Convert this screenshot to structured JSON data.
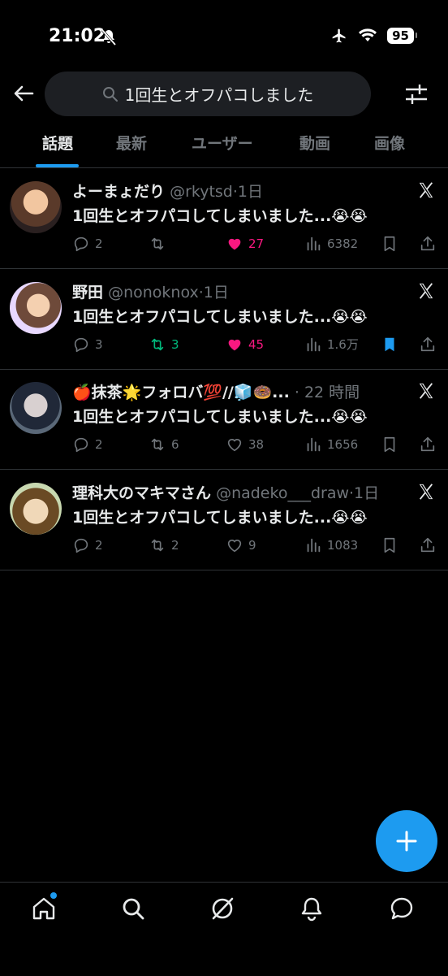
{
  "status": {
    "time": "21:02",
    "battery": "95"
  },
  "search": {
    "query": "1回生とオフパコしました"
  },
  "tabs": [
    "話題",
    "最新",
    "ユーザー",
    "動画",
    "画像"
  ],
  "tweets": [
    {
      "name": "よーまょだり",
      "handle": "@rkytsd",
      "time": "·1日",
      "text": "1回生とオフパコしてしまいました...😭😭",
      "replies": "2",
      "retweets": "",
      "likes": "27",
      "views": "6382",
      "liked": true,
      "retweeted": false,
      "bookmarked": false
    },
    {
      "name": "野田",
      "handle": "@nonoknox",
      "time": "·1日",
      "text": "1回生とオフパコしてしまいました...😭😭",
      "replies": "3",
      "retweets": "3",
      "likes": "45",
      "views": "1.6万",
      "liked": true,
      "retweeted": true,
      "bookmarked": true
    },
    {
      "name": "🍎抹茶🌟フォロバ💯//🧊🍩...",
      "handle": "",
      "time": "· 22 時間",
      "text": "1回生とオフパコしてしまいました...😭😭",
      "replies": "2",
      "retweets": "6",
      "likes": "38",
      "views": "1656",
      "liked": false,
      "retweeted": false,
      "bookmarked": false
    },
    {
      "name": "理科大のマキマさん",
      "handle": "@nadeko___draw",
      "time": "·1日",
      "text": "1回生とオフパコしてしまいました...😭😭",
      "replies": "2",
      "retweets": "2",
      "likes": "9",
      "views": "1083",
      "liked": false,
      "retweeted": false,
      "bookmarked": false
    }
  ],
  "colors": {
    "accent": "#1d9bf0",
    "like": "#f91880",
    "retweet": "#00ba7c",
    "muted": "#71767b"
  }
}
